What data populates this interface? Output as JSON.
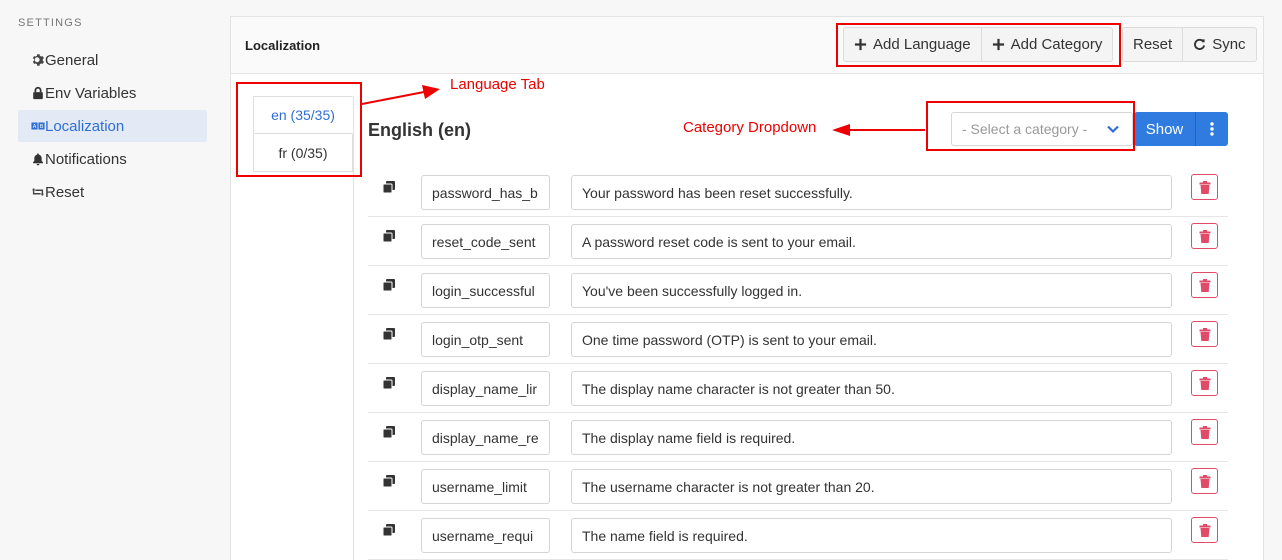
{
  "sidebar": {
    "heading": "SETTINGS",
    "items": [
      {
        "label": "General",
        "icon": "gear-icon"
      },
      {
        "label": "Env Variables",
        "icon": "lock-icon"
      },
      {
        "label": "Localization",
        "icon": "ab-icon",
        "active": true
      },
      {
        "label": "Notifications",
        "icon": "bell-icon"
      },
      {
        "label": "Reset",
        "icon": "retweet-icon"
      }
    ]
  },
  "header": {
    "title": "Localization",
    "add_language": "Add Language",
    "add_category": "Add Category",
    "reset": "Reset",
    "sync": "Sync"
  },
  "languages": {
    "tabs": [
      {
        "label": "en (35/35)",
        "active": true
      },
      {
        "label": "fr (0/35)",
        "active": false
      }
    ],
    "current_heading": "English (en)"
  },
  "category": {
    "placeholder": "- Select a category -",
    "show_label": "Show"
  },
  "rows": [
    {
      "key": "password_has_b",
      "value": "Your password has been reset successfully."
    },
    {
      "key": "reset_code_sent",
      "value": "A password reset code is sent to your email."
    },
    {
      "key": "login_successful",
      "value": "You've been successfully logged in."
    },
    {
      "key": "login_otp_sent",
      "value": "One time password (OTP) is sent to your email."
    },
    {
      "key": "display_name_lir",
      "value": "The display name character is not greater than 50."
    },
    {
      "key": "display_name_re",
      "value": "The display name field is required."
    },
    {
      "key": "username_limit",
      "value": "The username character is not greater than 20."
    },
    {
      "key": "username_requi",
      "value": "The name field is required."
    }
  ],
  "annotations": {
    "language_tab": "Language Tab",
    "category_dropdown": "Category Dropdown",
    "color": "#ee0000"
  },
  "colors": {
    "accent": "#2f7be0",
    "active_sidebar_bg": "#e4eaf5",
    "delete": "#e04b6a"
  }
}
